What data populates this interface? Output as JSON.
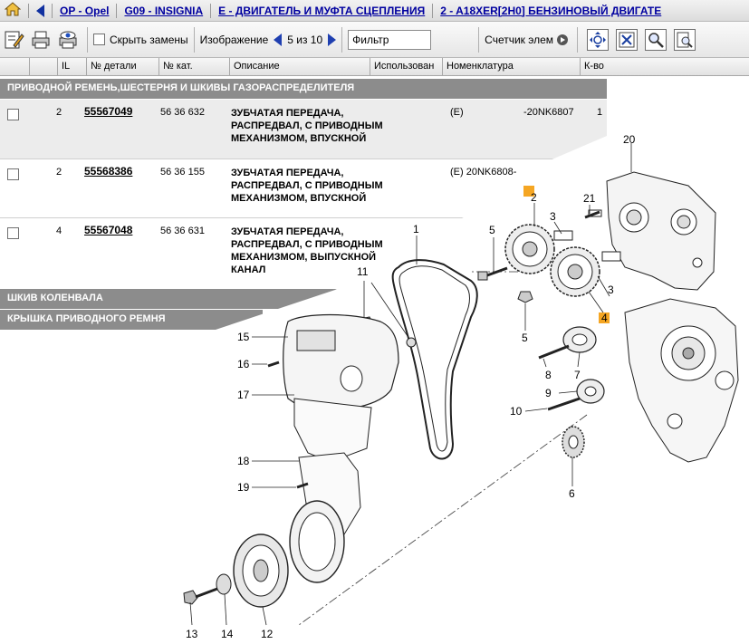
{
  "breadcrumb": {
    "items": [
      {
        "label": "OP - Opel"
      },
      {
        "label": "G09 - INSIGNIA"
      },
      {
        "label": "E - ДВИГАТЕЛЬ И МУФТА СЦЕПЛЕНИЯ"
      },
      {
        "label": "2 - A18XER[2H0] БЕНЗИНОВЫЙ ДВИГАТЕ"
      }
    ]
  },
  "toolbar": {
    "hide_replacements_label": "Скрыть замены",
    "image_label": "Изображение",
    "image_counter": "5 из 10",
    "filter_value": "Фильтр",
    "counter_label": "Счетчик элем"
  },
  "columns": [
    "IL",
    "№ детали",
    "№ кат.",
    "Описание",
    "Использован",
    "Номенклатура",
    "К-во"
  ],
  "sections": [
    "ПРИВОДНОЙ РЕМЕНЬ,ШЕСТЕРНЯ И ШКИВЫ ГАЗОРАСПРЕДЕЛИТЕЛЯ",
    "ШКИВ КОЛЕНВАЛА",
    "КРЫШКА ПРИВОДНОГО РЕМНЯ"
  ],
  "parts": [
    {
      "il": "2",
      "part_no": "55567049",
      "cat_no": "56 36 632",
      "desc": "ЗУБЧАТАЯ ПЕРЕДАЧА, РАСПРЕДВАЛ, С ПРИВОДНЫМ МЕХАНИЗМОМ, ВПУСКНОЙ",
      "nom": "(E)",
      "nom2": "-20NK6807",
      "qty": "1"
    },
    {
      "il": "2",
      "part_no": "55568386",
      "cat_no": "56 36 155",
      "desc": "ЗУБЧАТАЯ ПЕРЕДАЧА, РАСПРЕДВАЛ, С ПРИВОДНЫМ МЕХАНИЗМОМ, ВПУСКНОЙ",
      "nom": "(E) 20NK6808-",
      "nom2": "",
      "qty": ""
    },
    {
      "il": "4",
      "part_no": "55567048",
      "cat_no": "56 36 631",
      "desc": "ЗУБЧАТАЯ ПЕРЕДАЧА, РАСПРЕДВАЛ, С ПРИВОДНЫМ МЕХАНИЗМОМ, ВЫПУСКНОЙ КАНАЛ",
      "nom": "",
      "nom2": "",
      "qty": ""
    }
  ],
  "diagram": {
    "callouts": [
      "1",
      "2",
      "3",
      "3",
      "4",
      "5",
      "5",
      "6",
      "7",
      "8",
      "9",
      "10",
      "11",
      "12",
      "13",
      "14",
      "15",
      "16",
      "17",
      "18",
      "19",
      "20",
      "21"
    ]
  },
  "colors": {
    "link": "#0000a0",
    "section_bg": "#8c8c8c",
    "highlight": "#f5a623"
  }
}
